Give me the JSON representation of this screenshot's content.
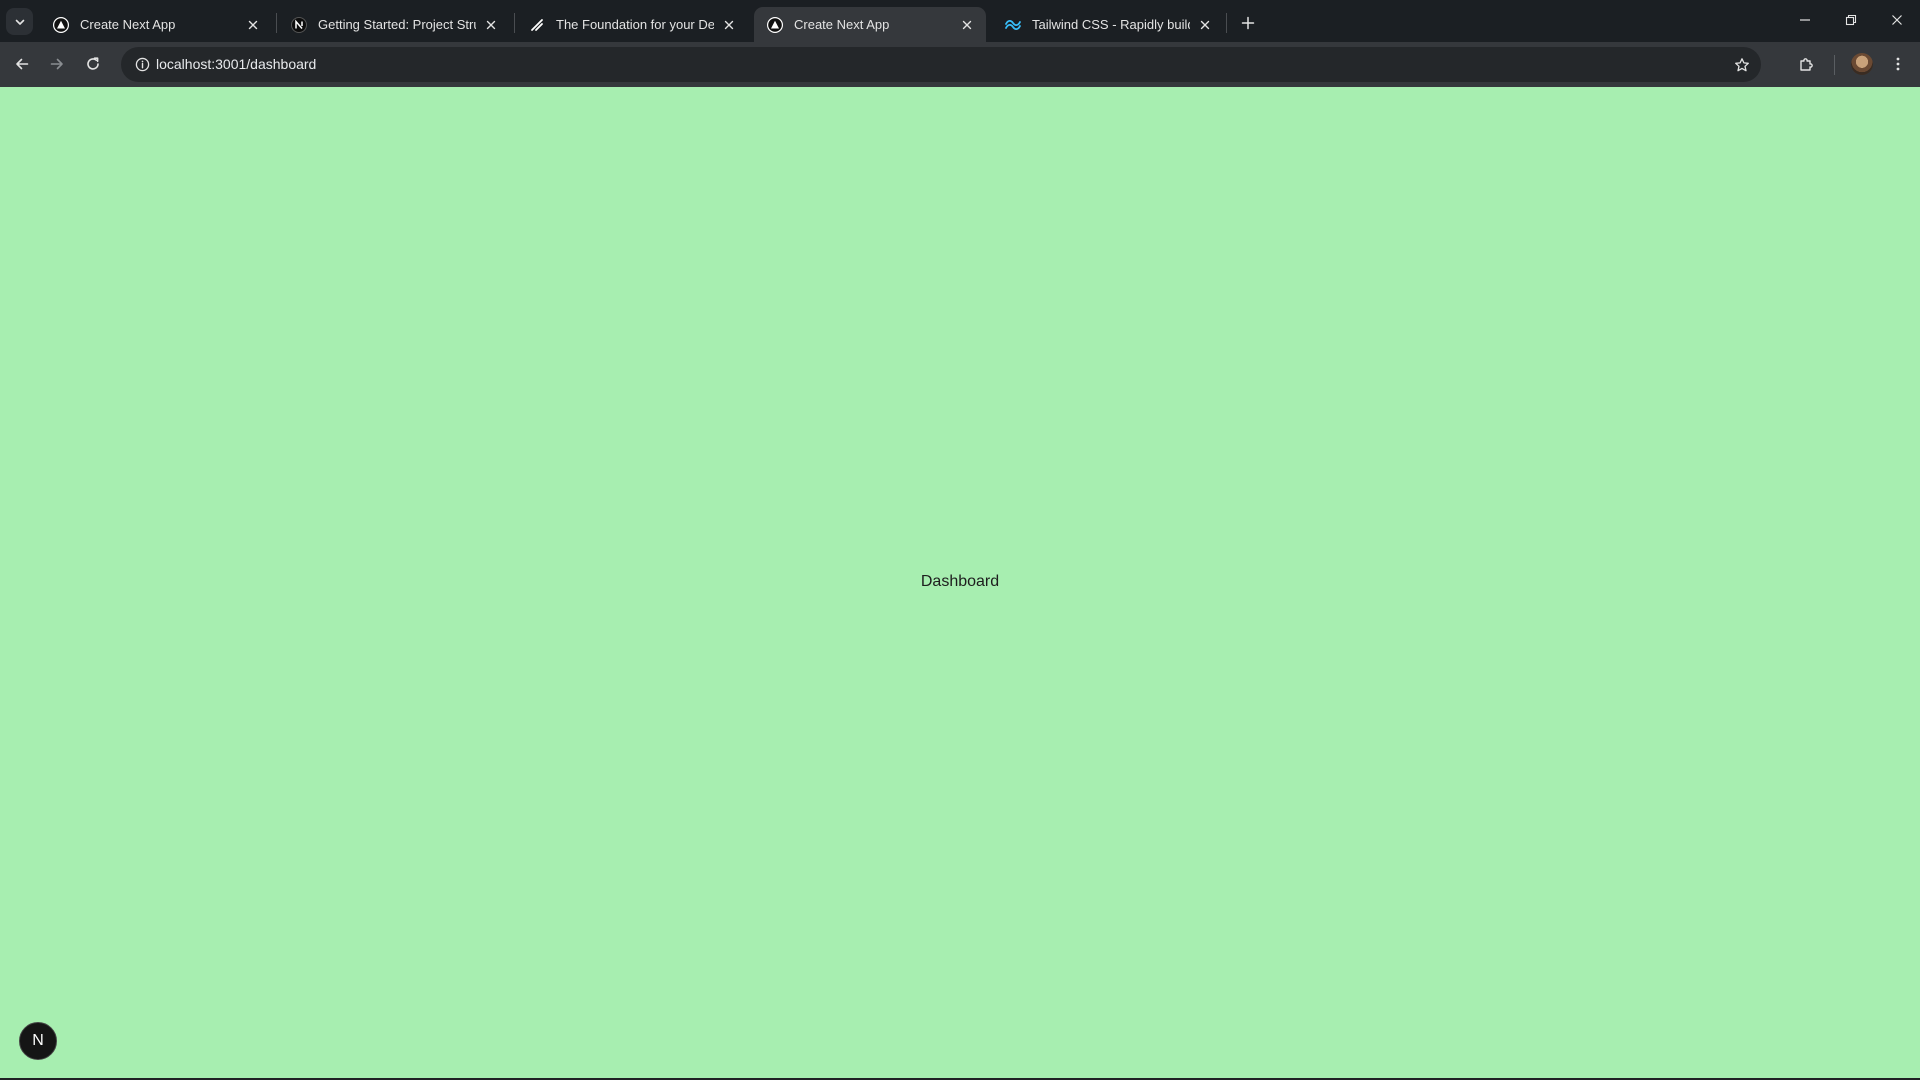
{
  "browser": {
    "tabs": [
      {
        "title": "Create Next App",
        "favicon": "nextjs-triangle-icon",
        "active": false
      },
      {
        "title": "Getting Started: Project Structu",
        "favicon": "nextjs-n-icon",
        "active": false
      },
      {
        "title": "The Foundation for your Desigr",
        "favicon": "shadcn-slash-icon",
        "active": false
      },
      {
        "title": "Create Next App",
        "favicon": "nextjs-triangle-icon",
        "active": true
      },
      {
        "title": "Tailwind CSS - Rapidly build mo",
        "favicon": "tailwind-wave-icon",
        "active": false
      }
    ],
    "url": "localhost:3001/dashboard"
  },
  "page": {
    "text": "Dashboard",
    "background": "#a7eeb0",
    "dev_badge_letter": "N"
  },
  "colors": {
    "tabstrip": "#1b1f23",
    "toolbar": "#35383c",
    "omnibox": "#24272a"
  }
}
